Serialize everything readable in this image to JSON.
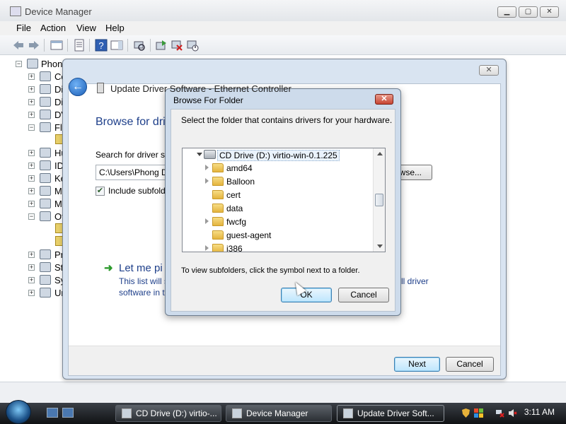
{
  "device_manager": {
    "title": "Device Manager",
    "menu": [
      "File",
      "Action",
      "View",
      "Help"
    ],
    "tree": [
      {
        "label": "Phon",
        "expander": "−"
      },
      {
        "label": "Co",
        "expander": "+"
      },
      {
        "label": "Di",
        "expander": "+"
      },
      {
        "label": "Di",
        "expander": "+"
      },
      {
        "label": "DV",
        "expander": "+"
      },
      {
        "label": "Fl",
        "expander": "−"
      },
      {
        "label": "Hu",
        "expander": "+"
      },
      {
        "label": "ID",
        "expander": "+"
      },
      {
        "label": "Ke",
        "expander": "+"
      },
      {
        "label": "M",
        "expander": "+"
      },
      {
        "label": "M",
        "expander": "+"
      },
      {
        "label": "Ot",
        "expander": "−"
      },
      {
        "label": "Pr",
        "expander": "+"
      },
      {
        "label": "St",
        "expander": "+"
      },
      {
        "label": "Sy",
        "expander": "+"
      },
      {
        "label": "Ur",
        "expander": "+"
      }
    ]
  },
  "wizard": {
    "title": "Update Driver Software - Ethernet Controller",
    "heading": "Browse for dri",
    "search_label": "Search for driver so",
    "path_value": "C:\\Users\\Phong D",
    "browse_label": "Browse...",
    "include_subfolders": "Include subfold",
    "let_me_pick": "Let me pi",
    "desc_line1": "This list will s",
    "desc_line2": "software in t",
    "desc_right": "ll driver",
    "next_label": "Next",
    "cancel_label": "Cancel",
    "close_label": "✕"
  },
  "browse_folder": {
    "title": "Browse For Folder",
    "close_label": "✕",
    "description": "Select the folder that contains drivers for your hardware.",
    "root": "CD Drive (D:) virtio-win-0.1.225",
    "folders": [
      {
        "label": "amd64",
        "expandable": true
      },
      {
        "label": "Balloon",
        "expandable": true
      },
      {
        "label": "cert",
        "expandable": false
      },
      {
        "label": "data",
        "expandable": false
      },
      {
        "label": "fwcfg",
        "expandable": true
      },
      {
        "label": "guest-agent",
        "expandable": false
      },
      {
        "label": "i386",
        "expandable": true
      }
    ],
    "hint": "To view subfolders, click the symbol next to a folder.",
    "ok_label": "OK",
    "cancel_label": "Cancel"
  },
  "taskbar": {
    "buttons": [
      {
        "label": "CD Drive (D:) virtio-...",
        "active": false
      },
      {
        "label": "Device Manager",
        "active": false
      },
      {
        "label": "Update Driver Soft...",
        "active": true
      }
    ],
    "clock": "3:11 AM"
  },
  "colors": {
    "accent": "#1e3f8a",
    "close_red": "#c74533",
    "taskbar": "#101214"
  }
}
